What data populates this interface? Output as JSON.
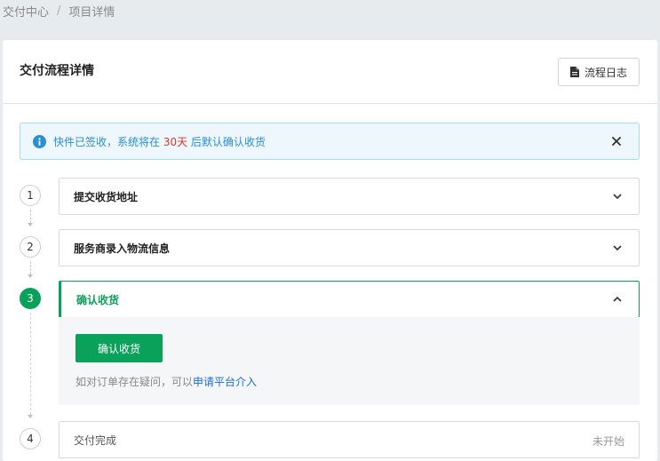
{
  "breadcrumb": {
    "items": [
      "交付中心",
      "项目详情"
    ],
    "separator": "/"
  },
  "header": {
    "title": "交付流程详情",
    "log_button": "流程日志"
  },
  "alert": {
    "text_before": "快件已签收，系统将在 ",
    "highlight": "30天",
    "text_after": " 后默认确认收货"
  },
  "steps": [
    {
      "num": "1",
      "label": "提交收货地址"
    },
    {
      "num": "2",
      "label": "服务商录入物流信息"
    },
    {
      "num": "3",
      "label": "确认收货"
    },
    {
      "num": "4",
      "label": "交付完成",
      "status": "未开始"
    }
  ],
  "confirm": {
    "button": "确认收货",
    "hint_text": "如对订单存在疑问，可以",
    "hint_link": "申请平台介入"
  },
  "colors": {
    "accent_green": "#0aa15a",
    "info_blue": "#2b8fd6",
    "highlight_red": "#e0342c",
    "link_blue": "#1a6fd1"
  }
}
